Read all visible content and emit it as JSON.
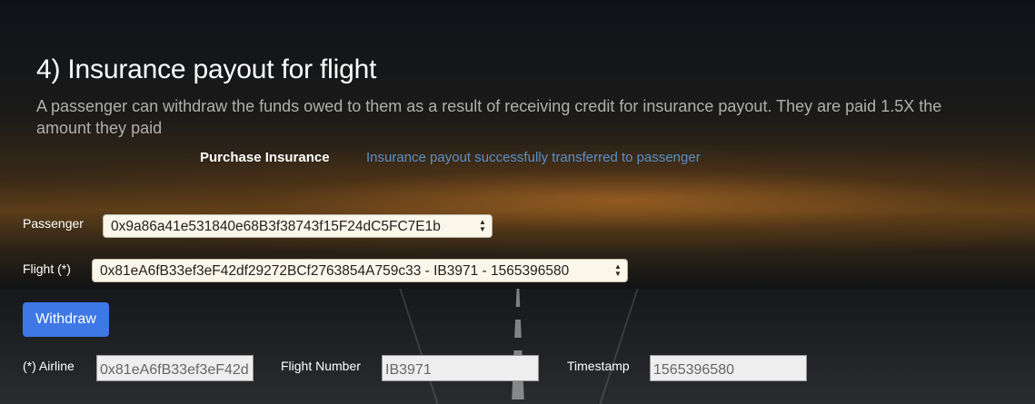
{
  "header": {
    "title": "4) Insurance payout for flight",
    "description": "A passenger can withdraw the funds owed to them as a result of receiving credit for insurance payout. They are paid 1.5X the amount they paid"
  },
  "status": {
    "label": "Purchase Insurance",
    "message": "Insurance payout successfully transferred to passenger"
  },
  "form": {
    "passenger": {
      "label": "Passenger",
      "selected": "0x9a86a41e531840e68B3f38743f15F24dC5FC7E1b"
    },
    "flight": {
      "label": "Flight (*)",
      "selected": "0x81eA6fB33ef3eF42df29272BCf2763854A759c33 - IB3971 - 1565396580"
    },
    "withdraw_label": "Withdraw",
    "airline": {
      "label": "(*) Airline",
      "value": "0x81eA6fB33ef3eF42d"
    },
    "flight_number": {
      "label": "Flight Number",
      "value": "IB3971"
    },
    "timestamp": {
      "label": "Timestamp",
      "value": "1565396580"
    }
  },
  "colors": {
    "button": "#3e78e6",
    "status_message": "#5a90c8"
  }
}
